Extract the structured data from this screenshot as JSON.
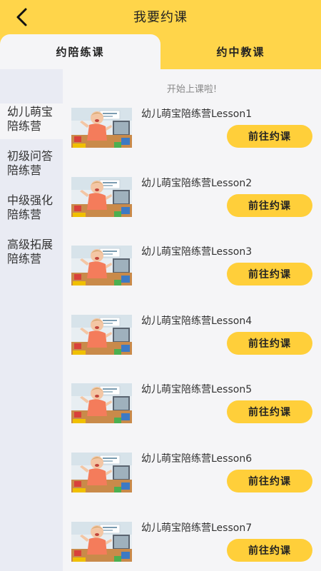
{
  "header": {
    "title": "我要约课"
  },
  "tabs": [
    {
      "label": "约陪练课"
    },
    {
      "label": "约中教课"
    }
  ],
  "sidebar": {
    "items": [
      {
        "line1": "幼儿萌宝",
        "line2": "陪练营"
      },
      {
        "line1": "初级问答",
        "line2": "陪练营"
      },
      {
        "line1": "中级强化",
        "line2": "陪练营"
      },
      {
        "line1": "高级拓展",
        "line2": "陪练营"
      }
    ]
  },
  "main": {
    "notice": "开始上课啦!",
    "lessons": [
      {
        "title": "幼儿萌宝陪练营Lesson1",
        "button": "前往约课"
      },
      {
        "title": "幼儿萌宝陪练营Lesson2",
        "button": "前往约课"
      },
      {
        "title": "幼儿萌宝陪练营Lesson3",
        "button": "前往约课"
      },
      {
        "title": "幼儿萌宝陪练营Lesson4",
        "button": "前往约课"
      },
      {
        "title": "幼儿萌宝陪练营Lesson5",
        "button": "前往约课"
      },
      {
        "title": "幼儿萌宝陪练营Lesson6",
        "button": "前往约课"
      },
      {
        "title": "幼儿萌宝陪练营Lesson7",
        "button": "前往约课"
      }
    ]
  },
  "colors": {
    "accent": "#ffd54a",
    "button": "#ffcf3a",
    "sidebar_bg": "#e9ebf3",
    "page_bg": "#f5f5f7"
  }
}
